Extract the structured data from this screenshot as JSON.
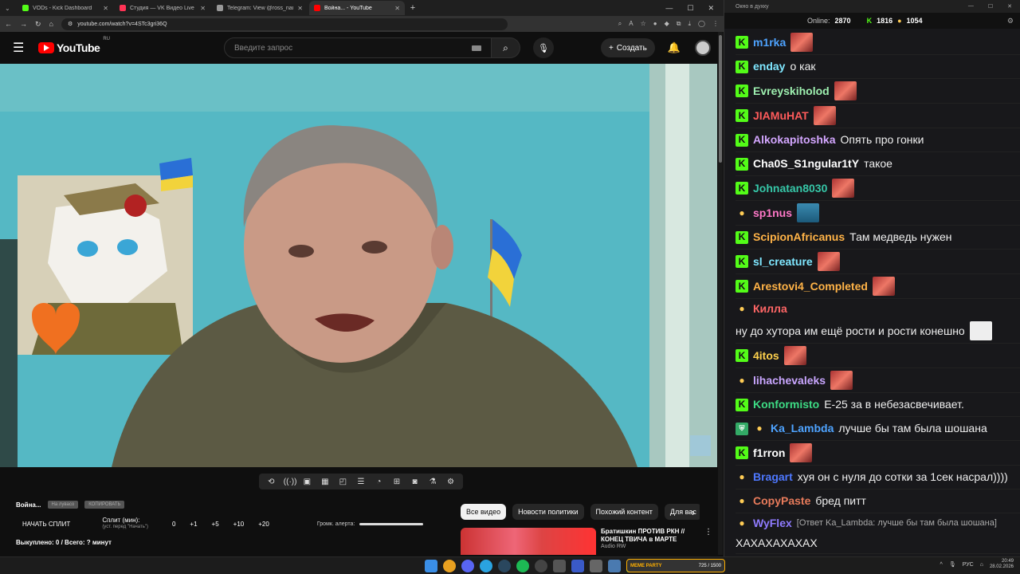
{
  "browser": {
    "tabs": [
      {
        "label": "VODs - Kick Dashboard",
        "color": "#53fc18",
        "active": false
      },
      {
        "label": "Студия — VK Видео Live",
        "color": "#ff3355",
        "active": false
      },
      {
        "label": "Telegram: View @ross_name",
        "color": "#999999",
        "active": false
      },
      {
        "label": "Война... - YouTube",
        "color": "#ff0000",
        "active": true
      }
    ],
    "url": "youtube.com/watch?v=4STc3gri36Q"
  },
  "youtube": {
    "logo_text": "YouTube",
    "logo_region": "RU",
    "search_placeholder": "Введите запрос",
    "create_label": "Создать"
  },
  "overlay_counter": {
    "title": "Война...",
    "pill_1": "На лувасо",
    "pill_2": "КОПИРОВАТЬ",
    "start_split": "НАЧАТЬ СПЛИТ",
    "split_label": "Сплит (мин):",
    "split_sub": "(уст. перед \"Начать\")",
    "values": [
      "0",
      "+1",
      "+5",
      "+10",
      "+20"
    ],
    "volume_label": "Громк. алерта:",
    "bought": "Выкуплено: 0 / Всего: ? минут"
  },
  "chips": [
    "Все видео",
    "Новости политики",
    "Похожий контент",
    "Для вас"
  ],
  "recommendation": {
    "title": "Братишкин ПРОТИВ РКН // КОНЕЦ ТВИЧА в МАРТЕ",
    "channel": "Audio RW"
  },
  "taskbar": {
    "meme_label": "MEME PARTY",
    "meme_value": "725 / 1500",
    "lang": "РУС",
    "time": "20:49",
    "date": "28.02.2026"
  },
  "chat": {
    "window_title": "Окно в духку",
    "online_label": "Online:",
    "online_count": "2870",
    "kick_count": "1816",
    "other_count": "1054",
    "messages": [
      {
        "user": "m1rka",
        "color": "#4ea3ff",
        "text": "",
        "badge": "k",
        "emote": "face"
      },
      {
        "user": "enday",
        "color": "#7fe7ff",
        "text": "о как",
        "badge": "k",
        "emote": ""
      },
      {
        "user": "Evreyskiholod",
        "color": "#9ef0b0",
        "text": "",
        "badge": "k",
        "emote": "face"
      },
      {
        "user": "JIAMuHAT",
        "color": "#ff5b5b",
        "text": "",
        "badge": "k",
        "emote": "face"
      },
      {
        "user": "Alkokapitoshka",
        "color": "#d3a6ff",
        "text": "Опять про гонки",
        "badge": "k",
        "emote": ""
      },
      {
        "user": "Cha0S_S1ngular1tY",
        "color": "#ffffff",
        "text": "такое",
        "badge": "k",
        "emote": ""
      },
      {
        "user": "Johnatan8030",
        "color": "#36c7a8",
        "text": "",
        "badge": "k",
        "emote": "face"
      },
      {
        "user": "sp1nus",
        "color": "#ff78c8",
        "text": "",
        "badge": "t",
        "emote": "blue"
      },
      {
        "user": "ScipionAfricanus",
        "color": "#ffb347",
        "text": "Там медведь нужен",
        "badge": "k",
        "emote": ""
      },
      {
        "user": "sl_creature",
        "color": "#7fe7ff",
        "text": "",
        "badge": "k",
        "emote": "face"
      },
      {
        "user": "Arestovi4_Completed",
        "color": "#ffb347",
        "text": "",
        "badge": "k",
        "emote": "face"
      },
      {
        "user": "Килла",
        "color": "#ff6666",
        "text": "ну до хутора им ещё рости и рости конешно",
        "badge": "t",
        "emote": "cat"
      },
      {
        "user": "4itos",
        "color": "#ffd24d",
        "text": "",
        "badge": "k",
        "emote": "face"
      },
      {
        "user": "lihachevaleks",
        "color": "#c9a6ff",
        "text": "",
        "badge": "t",
        "emote": "face"
      },
      {
        "user": "Konformisto",
        "color": "#3ddc84",
        "text": "Е-25 за в небезасвечивает.",
        "badge": "k",
        "emote": ""
      },
      {
        "user": "Ka_Lambda",
        "color": "#4ea3ff",
        "text": "лучше бы там была шошана",
        "badge": "st",
        "emote": ""
      },
      {
        "user": "f1rron",
        "color": "#ffffff",
        "text": "",
        "badge": "k",
        "emote": "face"
      },
      {
        "user": "Bragart",
        "color": "#4e78ff",
        "text": "хуя он с нуля до сотки за 1сек насрал))))",
        "badge": "t",
        "emote": ""
      },
      {
        "user": "CopyPaste",
        "color": "#e87b5b",
        "text": "бред питт",
        "badge": "t",
        "emote": ""
      },
      {
        "user": "WyFlex",
        "color": "#8f7bff",
        "text": "ХАХАХАХАХАХ",
        "badge": "t",
        "emote": "",
        "reply": "[Ответ Ka_Lambda: лучше бы там была шошана]"
      }
    ]
  }
}
